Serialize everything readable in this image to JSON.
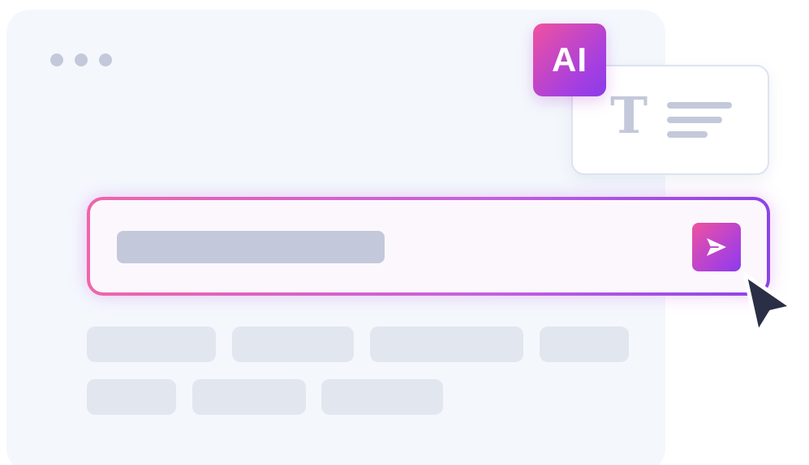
{
  "ai_badge": {
    "label": "AI"
  },
  "text_card": {
    "glyph": "T"
  },
  "colors": {
    "gradient_start": "#f051a0",
    "gradient_end": "#8a3ce8",
    "placeholder_gray": "#c3c9da",
    "chip_gray": "#e2e6ef",
    "window_bg": "#f4f8fd",
    "cursor": "#2a2f45"
  },
  "icons": {
    "send": "send-icon",
    "cursor": "mouse-pointer-icon",
    "text": "text-format-icon"
  }
}
